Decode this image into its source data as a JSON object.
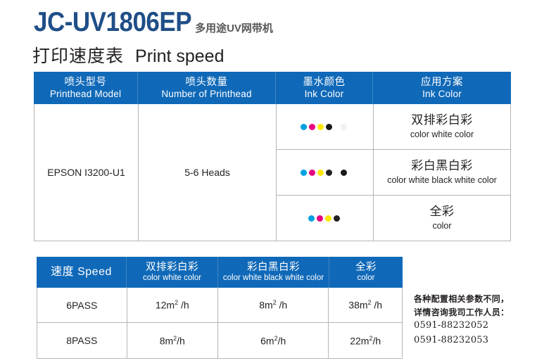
{
  "header": {
    "model": "JC-UV1806EP",
    "model_subtitle": "多用途UV网带机",
    "section_title_cn": "打印速度表",
    "section_title_en": "Print speed",
    "brand_blue": "#1f4e87",
    "header_blue": "#1069b8"
  },
  "spec_table": {
    "columns": [
      {
        "cn": "喷头型号",
        "en": "Printhead Model"
      },
      {
        "cn": "喷头数量",
        "en": "Number of Printhead"
      },
      {
        "cn": "墨水颜色",
        "en": "Ink Color"
      },
      {
        "cn": "应用方案",
        "en": "Ink Color"
      }
    ],
    "printhead_model": "EPSON I3200-U1",
    "printhead_number": "5-6 Heads",
    "rows": [
      {
        "ink_colors": [
          "#00a0e0",
          "#e6007e",
          "#ffe800",
          "#1a1a1a",
          "white"
        ],
        "ink_gap_before_index": 4,
        "scheme_cn": "双排彩白彩",
        "scheme_en": "color white color"
      },
      {
        "ink_colors": [
          "#00a0e0",
          "#e6007e",
          "#ffe800",
          "#231f20",
          "#1a1a1a"
        ],
        "ink_gap_before_index": 4,
        "scheme_cn": "彩白黑白彩",
        "scheme_en": "color white black white color"
      },
      {
        "ink_colors": [
          "#00a0e0",
          "#e6007e",
          "#ffe800",
          "#231f20"
        ],
        "ink_gap_before_index": -1,
        "scheme_cn": "全彩",
        "scheme_en": "color"
      }
    ]
  },
  "speed_table": {
    "columns": [
      {
        "cn": "速度",
        "en": "Speed",
        "combined": true
      },
      {
        "cn": "双排彩白彩",
        "en": "color white color"
      },
      {
        "cn": "彩白黑白彩",
        "en": "color white black white color"
      },
      {
        "cn": "全彩",
        "en": "color"
      }
    ],
    "rows": [
      {
        "pass": "6PASS",
        "values": [
          "12m2 /h",
          "8m2 /h",
          "38m2 /h"
        ]
      },
      {
        "pass": "8PASS",
        "values": [
          "8m2/h",
          "6m2/h",
          "22m2/h"
        ]
      }
    ],
    "value_parts": [
      [
        {
          "num": "12",
          "unit": "m",
          "sup": "2",
          "tail": " /h"
        },
        {
          "num": "8",
          "unit": "m",
          "sup": "2",
          "tail": " /h"
        },
        {
          "num": "38",
          "unit": "m",
          "sup": "2",
          "tail": " /h"
        }
      ],
      [
        {
          "num": "8",
          "unit": "m",
          "sup": "2",
          "tail": "/h"
        },
        {
          "num": "6",
          "unit": "m",
          "sup": "2",
          "tail": "/h"
        },
        {
          "num": "22",
          "unit": "m",
          "sup": "2",
          "tail": "/h"
        }
      ]
    ]
  },
  "note": {
    "line1": "各种配置相关参数不同，",
    "line2": "详情咨询我司工作人员：",
    "line3": "0591-88232052",
    "line4": "0591-88232053"
  }
}
